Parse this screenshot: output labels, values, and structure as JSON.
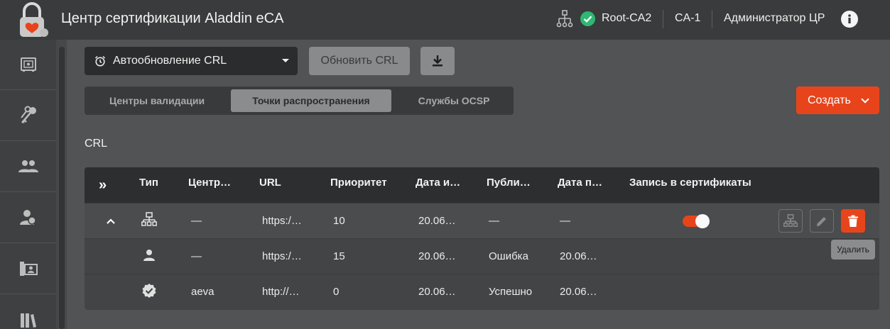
{
  "header": {
    "title": "Центр сертификации Aladdin eCA",
    "root_ca": "Root-CA2",
    "ca": "CA-1",
    "user": "Администратор ЦР"
  },
  "sidebar": {
    "items": [
      {
        "icon": "safe-icon"
      },
      {
        "icon": "keys-icon"
      },
      {
        "icon": "users-icon"
      },
      {
        "icon": "user-certificate-icon"
      },
      {
        "icon": "profile-card-icon"
      },
      {
        "icon": "books-icon"
      }
    ]
  },
  "toolbar": {
    "crl_dropdown": "Автообновление CRL",
    "refresh_label": "Обновить CRL",
    "create_label": "Создать"
  },
  "tabs": [
    {
      "label": "Центры валидации",
      "active": false
    },
    {
      "label": "Точки распространения",
      "active": true
    },
    {
      "label": "Службы OCSP",
      "active": false
    }
  ],
  "section_label": "CRL",
  "table": {
    "columns": [
      "Тип",
      "Центр…",
      "URL",
      "Приоритет",
      "Дата и…",
      "Публи…",
      "Дата п…",
      "Запись в сертификаты"
    ],
    "rows": [
      {
        "type_icon": "hierarchy-icon",
        "center": "—",
        "url": "https:/…",
        "priority": "10",
        "date1": "20.06…",
        "pub": "—",
        "date2": "—",
        "write_to_certs": true
      },
      {
        "type_icon": "person-icon",
        "center": "—",
        "url": "https:/…",
        "priority": "15",
        "date1": "20.06…",
        "pub": "Ошибка",
        "date2": "20.06…"
      },
      {
        "type_icon": "verified-icon",
        "center": "aeva",
        "url": "http://…",
        "priority": "0",
        "date1": "20.06…",
        "pub": "Успешно",
        "date2": "20.06…"
      }
    ]
  },
  "tooltip": "Удалить",
  "colors": {
    "accent": "#e8441c",
    "status_ok": "#2eb872"
  }
}
